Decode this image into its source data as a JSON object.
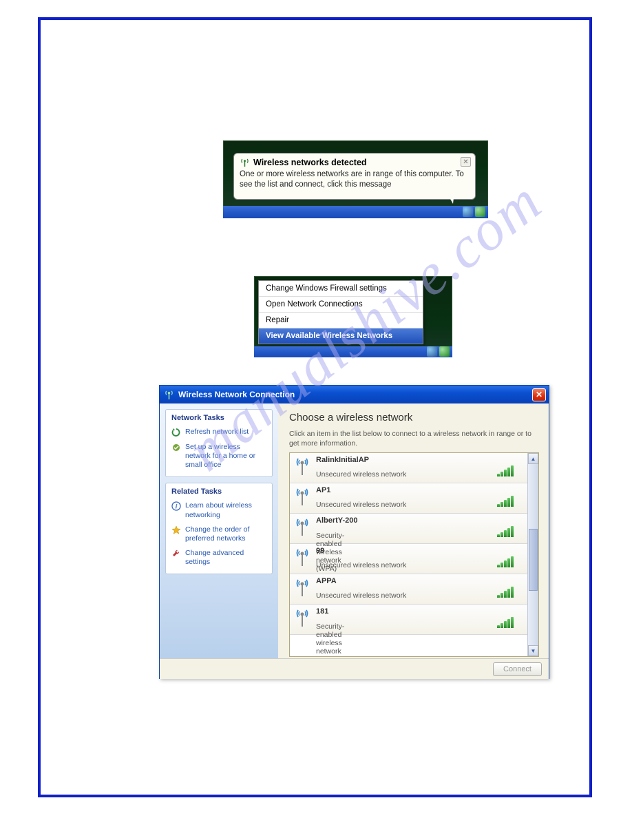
{
  "watermark": "manualshive.com",
  "balloon": {
    "title": "Wireless networks detected",
    "message": "One or more wireless networks are in range of this computer. To see the list and connect, click this message"
  },
  "context_menu": {
    "items": [
      {
        "label": "Change Windows Firewall settings",
        "selected": false
      },
      {
        "label": "Open Network Connections",
        "selected": false
      },
      {
        "label": "Repair",
        "selected": false
      },
      {
        "label": "View Available Wireless Networks",
        "selected": true
      }
    ]
  },
  "window": {
    "title": "Wireless Network Connection",
    "sidebar": {
      "panel1_head": "Network Tasks",
      "panel1_links": [
        {
          "icon": "refresh",
          "label": "Refresh network list"
        },
        {
          "icon": "setup",
          "label": "Set up a wireless network for a home or small office"
        }
      ],
      "panel2_head": "Related Tasks",
      "panel2_links": [
        {
          "icon": "info",
          "label": "Learn about wireless networking"
        },
        {
          "icon": "star",
          "label": "Change the order of preferred networks"
        },
        {
          "icon": "wrench",
          "label": "Change advanced settings"
        }
      ]
    },
    "main": {
      "heading": "Choose a wireless network",
      "subtext": "Click an item in the list below to connect to a wireless network in range or to get more information.",
      "networks": [
        {
          "name": "RalinkInitialAP",
          "desc": "Unsecured wireless network",
          "secured": false,
          "strength": 5
        },
        {
          "name": "AP1",
          "desc": "Unsecured wireless network",
          "secured": false,
          "strength": 5
        },
        {
          "name": "AlbertY-200",
          "desc": "Security-enabled wireless network (WPA)",
          "secured": true,
          "strength": 5
        },
        {
          "name": "99",
          "desc": "Unsecured wireless network",
          "secured": false,
          "strength": 5
        },
        {
          "name": "APPA",
          "desc": "Unsecured wireless network",
          "secured": false,
          "strength": 5
        },
        {
          "name": "181",
          "desc": "Security-enabled wireless network",
          "secured": true,
          "strength": 5
        }
      ],
      "connect_button": "Connect"
    }
  },
  "icons": {
    "refresh_color": "#2a8a3a",
    "setup_color": "#7aa83a",
    "info_color": "#3868c0",
    "star_color": "#f0b820",
    "wrench_color": "#c03838"
  }
}
